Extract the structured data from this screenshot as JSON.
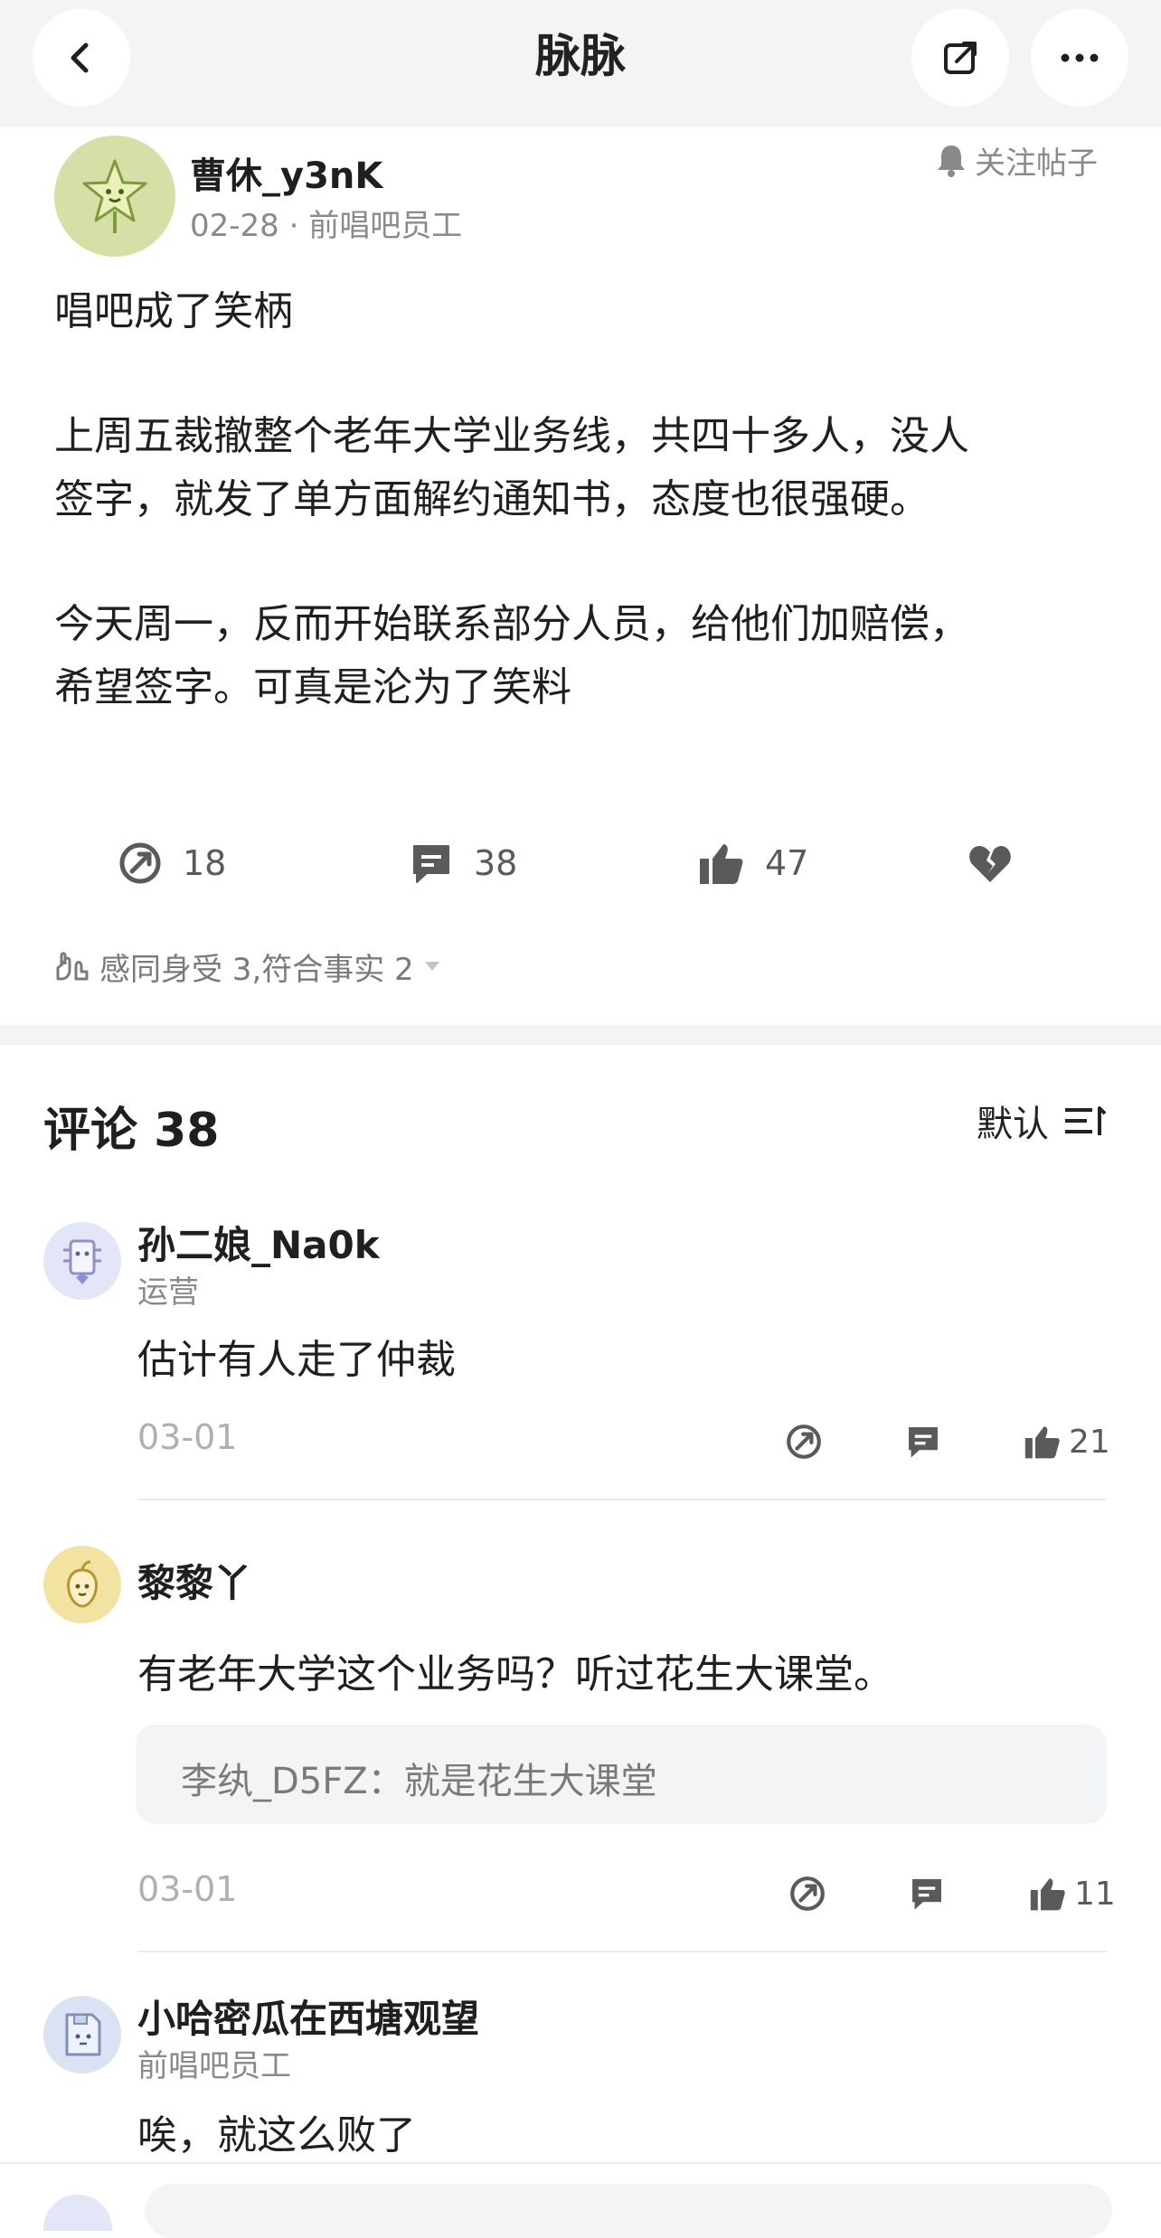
{
  "app": {
    "title": "脉脉"
  },
  "post": {
    "author": "曹休_y3nK",
    "meta": "02-28 · 前唱吧员工",
    "follow_label": "关注帖子",
    "lines": [
      "唱吧成了笑柄",
      "上周五裁撤整个老年大学业务线，共四十多人，没人",
      "签字，就发了单方面解约通知书，态度也很强硬。",
      "今天周一，反而开始联系部分人员，给他们加赔偿，",
      "希望签字。可真是沦为了笑料"
    ],
    "actions": {
      "share": "18",
      "comment": "38",
      "like": "47"
    },
    "reactions": "感同身受 3,符合事实 2"
  },
  "comments_header": {
    "title": "评论 38",
    "sort": "默认"
  },
  "comments": [
    {
      "name": "孙二娘_Na0k",
      "role": "运营",
      "text": "估计有人走了仲裁",
      "date": "03-01",
      "likes": "21"
    },
    {
      "name": "黎黎丫",
      "role": "",
      "text": "有老年大学这个业务吗？听过花生大课堂。",
      "reply": "李纨_D5FZ：就是花生大课堂",
      "date": "03-01",
      "likes": "11"
    },
    {
      "name": "小哈密瓜在西塘观望",
      "role": "前唱吧员工",
      "text": "唉，就这么败了"
    }
  ],
  "colors": {
    "topbar": "#f3f4f6",
    "icon": "#5a5a5a",
    "muted": "#8a8a8a"
  }
}
